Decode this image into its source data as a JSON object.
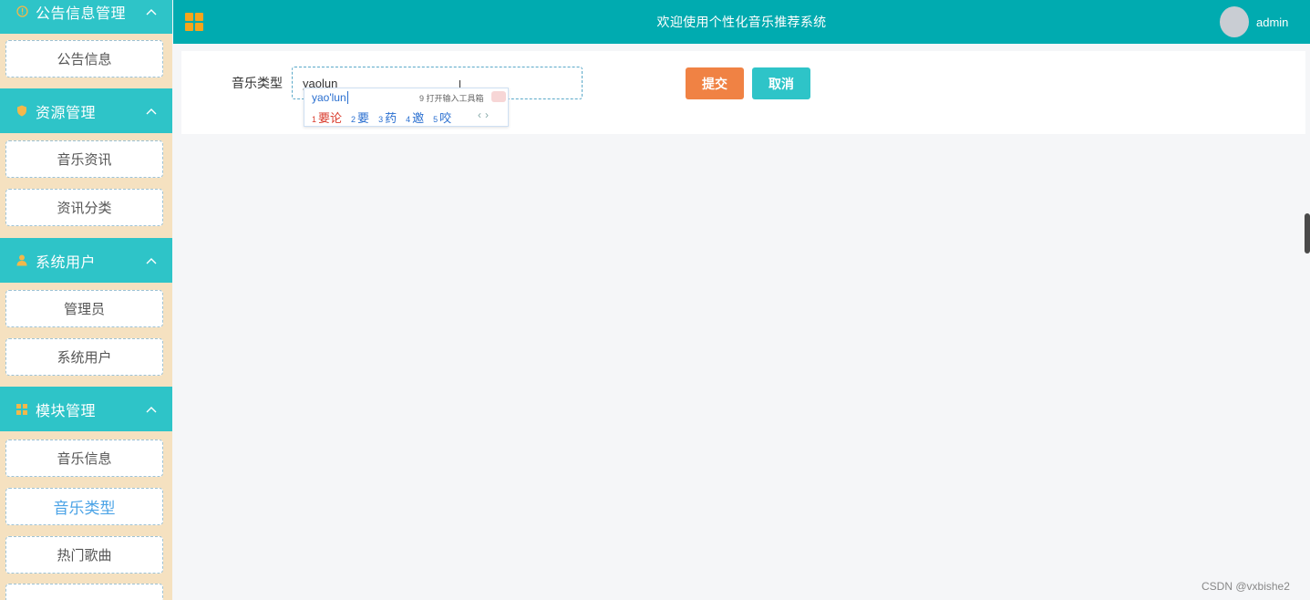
{
  "sidebar": {
    "groups": [
      {
        "label": "公告信息管理",
        "icon": "info-circle-icon",
        "items": [
          "公告信息"
        ]
      },
      {
        "label": "资源管理",
        "icon": "shield-icon",
        "items": [
          "音乐资讯",
          "资讯分类"
        ]
      },
      {
        "label": "系统用户",
        "icon": "user-icon",
        "items": [
          "管理员",
          "系统用户"
        ]
      },
      {
        "label": "模块管理",
        "icon": "grid-icon",
        "items": [
          "音乐信息",
          "音乐类型",
          "热门歌曲"
        ]
      }
    ],
    "active_item": "音乐类型"
  },
  "header": {
    "title": "欢迎使用个性化音乐推荐系统",
    "username": "admin"
  },
  "form": {
    "label": "音乐类型",
    "value": "yaolun",
    "submit_label": "提交",
    "cancel_label": "取消"
  },
  "ime": {
    "composition": "yao'lun",
    "hint": "9 打开输入工具箱",
    "candidates": [
      {
        "num": "1",
        "text": "要论"
      },
      {
        "num": "2",
        "text": "要"
      },
      {
        "num": "3",
        "text": "药"
      },
      {
        "num": "4",
        "text": "邀"
      },
      {
        "num": "5",
        "text": "咬"
      }
    ],
    "prev": "‹",
    "next": "›"
  },
  "watermark": "CSDN @vxbishe2",
  "colors": {
    "sidebar_bg": "#f5e1c0",
    "sidebar_header": "#2ec4c8",
    "topbar": "#00abb0",
    "submit": "#f08244",
    "cancel": "#2ec4c8",
    "active_item": "#4ba3e6",
    "icon_accent": "#f5a51c"
  }
}
